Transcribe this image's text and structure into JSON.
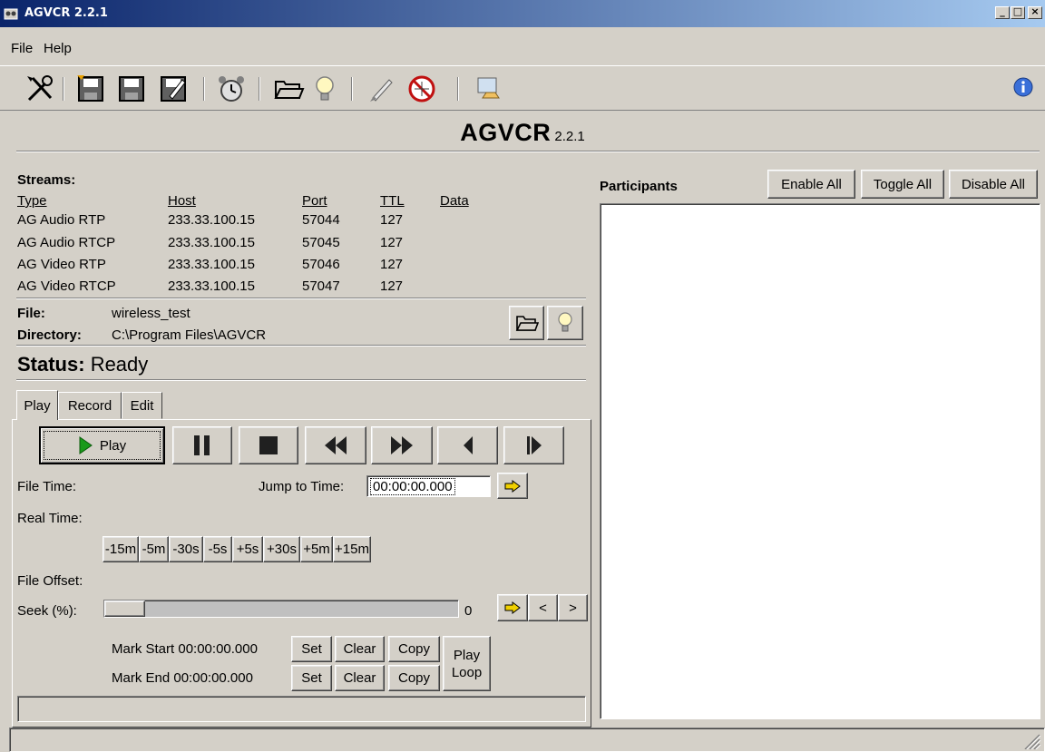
{
  "window": {
    "title": "AGVCR 2.2.1",
    "minimize_label": "_",
    "maximize_label": "□",
    "close_label": "×"
  },
  "menu": {
    "items": [
      {
        "label": "File"
      },
      {
        "label": "Help"
      }
    ]
  },
  "toolbar": {
    "icons": [
      "tools-icon",
      "save-as-icon",
      "save-icon",
      "edit-icon",
      "alarm-clock-icon",
      "open-folder-icon",
      "lightbulb-icon",
      "rocket-icon",
      "no-network-icon",
      "computer-venue-icon",
      "info-icon"
    ]
  },
  "heading": {
    "main": "AGVCR",
    "version": "2.2.1"
  },
  "streams": {
    "title": "Streams:",
    "headers": [
      "Type",
      "Host",
      "Port",
      "TTL",
      "Data"
    ],
    "rows": [
      [
        "AG Audio RTP",
        "233.33.100.15",
        "57044",
        "127",
        ""
      ],
      [
        "AG Audio RTCP",
        "233.33.100.15",
        "57045",
        "127",
        ""
      ],
      [
        "AG Video RTP",
        "233.33.100.15",
        "57046",
        "127",
        ""
      ],
      [
        "AG Video RTCP",
        "233.33.100.15",
        "57047",
        "127",
        ""
      ]
    ]
  },
  "file_info": {
    "file_label": "File:",
    "file_value": "wireless_test",
    "directory_label": "Directory:",
    "directory_value": "C:\\Program Files\\AGVCR"
  },
  "status": {
    "label": "Status:",
    "value": "Ready"
  },
  "tabs": [
    {
      "label": "Play",
      "active": true
    },
    {
      "label": "Record",
      "active": false
    },
    {
      "label": "Edit",
      "active": false
    }
  ],
  "play_panel": {
    "play_label": "Play",
    "file_time_label": "File Time:",
    "jump_to_time_label": "Jump to Time:",
    "jump_to_time_value": "00:00:00.000",
    "real_time_label": "Real Time:",
    "skip_buttons": [
      "-15m",
      "-5m",
      "-30s",
      "-5s",
      "+5s",
      "+30s",
      "+5m",
      "+15m"
    ],
    "file_offset_label": "File Offset:",
    "seek_label": "Seek (%):",
    "seek_value": "0",
    "seek_percent": 0,
    "prev_label": "<",
    "next_label": ">",
    "mark_start_label": "Mark Start",
    "mark_start_value": "00:00:00.000",
    "mark_end_label": "Mark End",
    "mark_end_value": "00:00:00.000",
    "set_label": "Set",
    "clear_label": "Clear",
    "copy_label": "Copy",
    "play_loop_line1": "Play",
    "play_loop_line2": "Loop"
  },
  "participants": {
    "title": "Participants",
    "enable_all": "Enable All",
    "toggle_all": "Toggle All",
    "disable_all": "Disable All"
  },
  "colors": {
    "face": "#d4d0c8",
    "title_start": "#0a246a",
    "title_end": "#a6caf0",
    "play_green": "#1a9a1a"
  }
}
